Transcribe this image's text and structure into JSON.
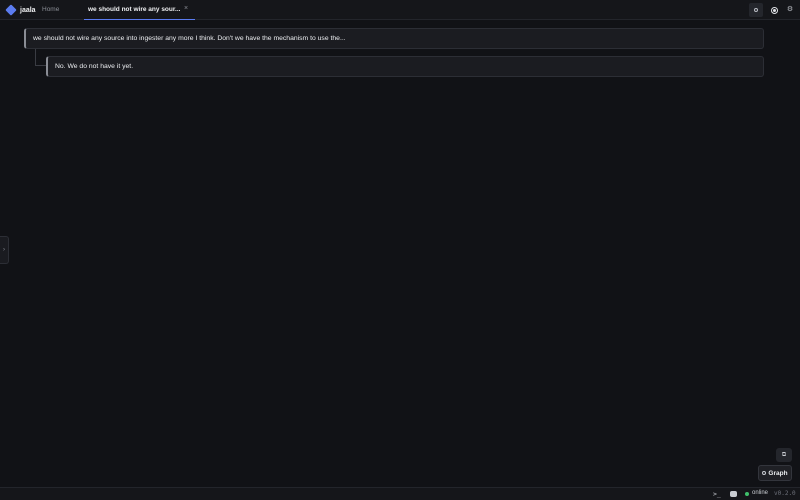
{
  "app": {
    "name": "jaala"
  },
  "tabs": [
    {
      "label": "Home",
      "active": false
    },
    {
      "label": "we should not wire any sour...",
      "active": true,
      "close_glyph": "×"
    }
  ],
  "toolbar": {
    "icons": [
      "search-icon",
      "record-icon",
      "gear-icon"
    ],
    "gear_glyph": "⚙"
  },
  "blocks": [
    {
      "text": "we should not wire any source into ingester any more I think. Don't we have the mechanism to use the..."
    },
    {
      "text": "No. We do not have it yet."
    }
  ],
  "side_handle": {
    "glyph": "›"
  },
  "floating": {
    "icon_glyph": "⧉",
    "graph_label": "Graph"
  },
  "statusbar": {
    "terminal_glyph": ">_",
    "status_text": "online",
    "status_color": "#3fbf6b",
    "version": "v0.2.0"
  },
  "colors": {
    "accent": "#5b7cf0",
    "background": "#111216"
  }
}
